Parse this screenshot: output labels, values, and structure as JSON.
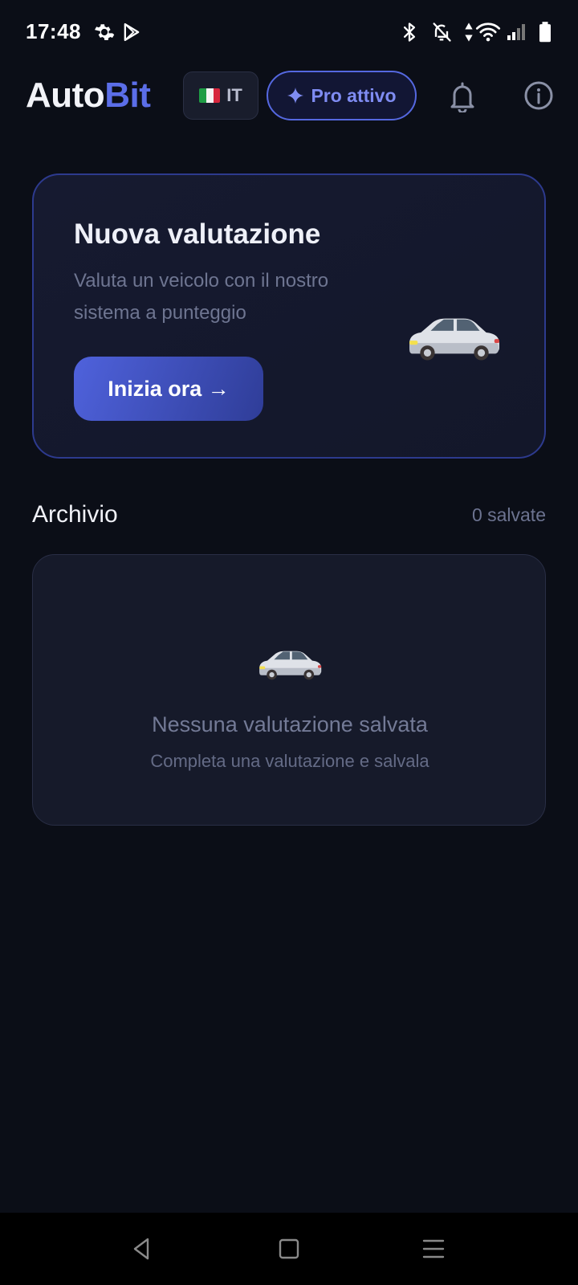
{
  "status_bar": {
    "time": "17:48",
    "icons": [
      "gear-icon",
      "play-store-icon",
      "bluetooth-icon",
      "notifications-off-icon",
      "data-arrows-icon",
      "wifi-icon",
      "signal-icon",
      "battery-icon"
    ]
  },
  "header": {
    "logo_part1": "Auto",
    "logo_part2": "Bit",
    "language": {
      "flag": "italy-flag",
      "label": "IT"
    },
    "pro_badge": {
      "icon": "sparkle-icon",
      "label": "Pro attivo"
    },
    "icons": [
      "bell-icon",
      "info-icon"
    ]
  },
  "new_evaluation": {
    "title": "Nuova valutazione",
    "description": "Valuta un veicolo con il nostro sistema a punteggio",
    "button_label": "Inizia ora →",
    "illustration": "car-icon"
  },
  "archive": {
    "title": "Archivio",
    "count_label": "0 salvate",
    "empty_state": {
      "illustration": "car-icon",
      "title": "Nessuna valutazione salvata",
      "subtitle": "Completa una valutazione e salvala"
    }
  },
  "nav_bar": {
    "icons": [
      "back-icon",
      "home-icon",
      "recents-icon"
    ]
  },
  "colors": {
    "background": "#0b0e17",
    "accent": "#5b6ee8",
    "card": "#161a2a"
  }
}
